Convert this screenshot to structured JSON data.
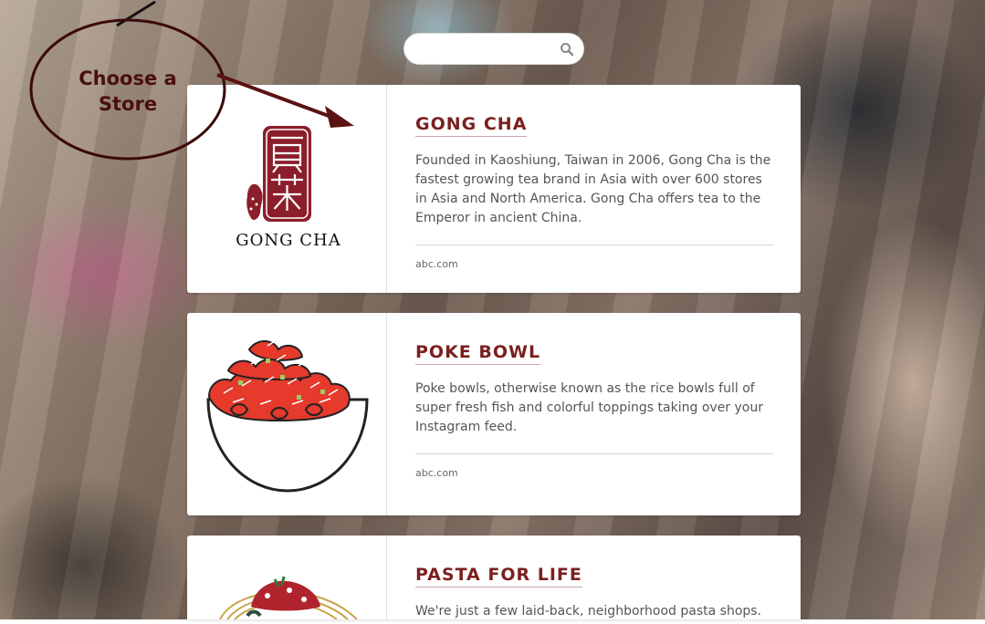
{
  "search": {
    "placeholder": "",
    "value": ""
  },
  "annotation": {
    "line1": "Choose a",
    "line2": "Store"
  },
  "stores": [
    {
      "title": "GONG CHA",
      "logo_text": "GONG CHA",
      "description": "Founded in Kaoshiung, Taiwan in 2006, Gong Cha is the fastest growing tea brand in Asia with over 600 stores in Asia and North America. Gong Cha offers tea to the Emperor in ancient China.",
      "link": "abc.com"
    },
    {
      "title": "POKE BOWL",
      "description": "Poke bowls, otherwise known as the rice bowls full of super fresh fish and colorful toppings taking over your Instagram feed.",
      "link": "abc.com"
    },
    {
      "title": "PASTA FOR LIFE",
      "description": "We're just a few laid-back, neighborhood pasta shops.",
      "link": ""
    }
  ],
  "colors": {
    "title": "#7a1f1f",
    "brand": "#8b1e2a"
  }
}
